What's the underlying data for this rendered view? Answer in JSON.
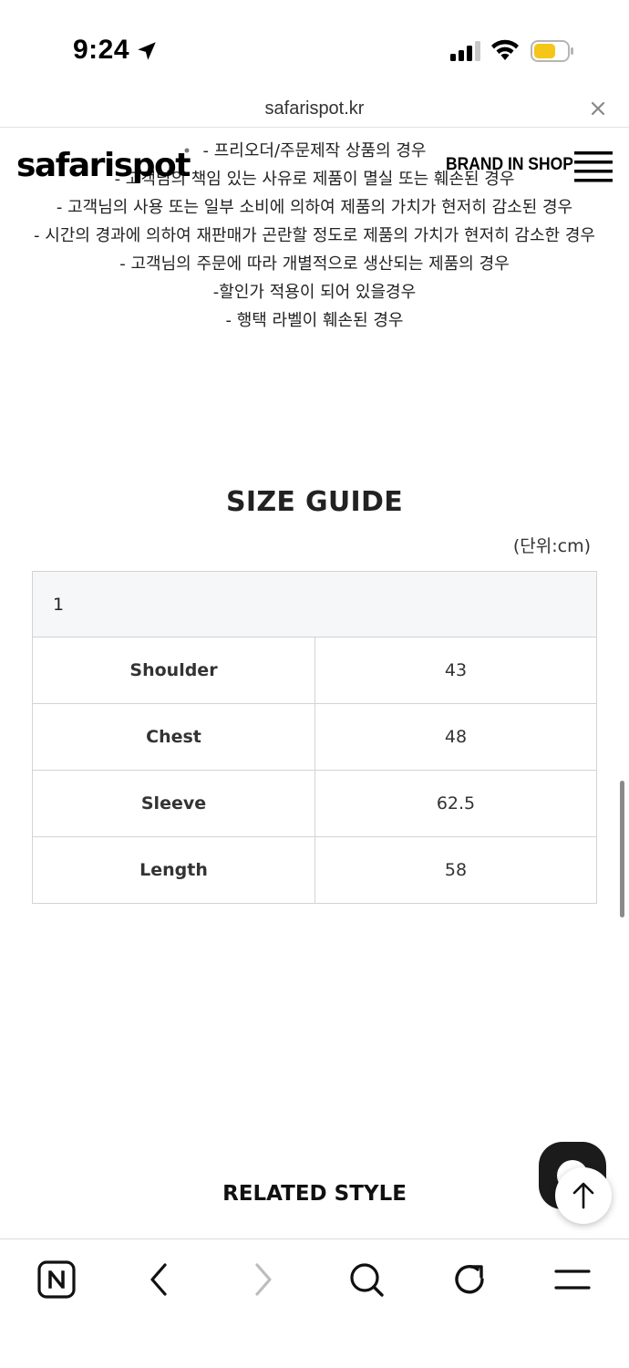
{
  "status_bar": {
    "time": "9:24",
    "battery_color": "#f5c518"
  },
  "url_bar": {
    "domain": "safarispot.kr"
  },
  "site_header": {
    "logo": "safarispot",
    "brand_in_shop": "BRAND IN SHOP"
  },
  "notice_lines": [
    "- 프리오더/주문제작 상품의 경우",
    "- 고객님의 책임 있는 사유로 제품이 멸실 또는 훼손된 경우",
    "- 고객님의 사용 또는 일부 소비에 의하여 제품의 가치가 현저히 감소된 경우",
    "- 시간의 경과에 의하여 재판매가 곤란할 정도로 제품의 가치가 현저히 감소한 경우",
    "- 고객님의 주문에 따라 개별적으로 생산되는 제품의 경우",
    "-할인가 적용이 되어 있을경우",
    "- 행택 라벨이 훼손된 경우"
  ],
  "size_guide": {
    "title": "SIZE GUIDE",
    "unit": "(단위:cm)",
    "size_header": "1",
    "rows": [
      {
        "label": "Shoulder",
        "value": "43"
      },
      {
        "label": "Chest",
        "value": "48"
      },
      {
        "label": "Sleeve",
        "value": "62.5"
      },
      {
        "label": "Length",
        "value": "58"
      }
    ]
  },
  "related": {
    "title": "RELATED STYLE"
  },
  "toolbar": {
    "icons": [
      "naver-icon",
      "back-icon",
      "forward-icon",
      "search-icon",
      "reload-icon",
      "menu-icon"
    ]
  }
}
